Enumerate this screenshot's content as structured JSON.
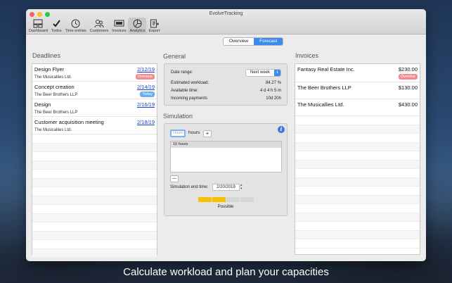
{
  "window": {
    "title": "EvolveTracking"
  },
  "toolbar": [
    {
      "label": "Dashboard",
      "icon": "dashboard-icon"
    },
    {
      "label": "Todos",
      "icon": "checkmark-icon"
    },
    {
      "label": "Time entries",
      "icon": "clock-icon"
    },
    {
      "label": "Customers",
      "icon": "people-icon"
    },
    {
      "label": "Invoices",
      "icon": "invoice-icon"
    },
    {
      "label": "Analytics",
      "icon": "analytics-icon",
      "active": true
    },
    {
      "label": "Export",
      "icon": "export-icon"
    }
  ],
  "view_switch": {
    "options": [
      "Overview",
      "Forecast"
    ],
    "selected": "Forecast"
  },
  "deadlines": {
    "title": "Deadlines",
    "items": [
      {
        "name": "Design Flyer",
        "date": "2/12/19",
        "client": "The Musicallies Ltd.",
        "badge": "Overdue"
      },
      {
        "name": "Concept creation",
        "date": "2/14/19",
        "client": "The Beer Brothers LLP",
        "badge": "Today"
      },
      {
        "name": "Design",
        "date": "2/16/19",
        "client": "The Beer Brothers LLP",
        "badge": ""
      },
      {
        "name": "Customer acquisition meeting",
        "date": "2/18/19",
        "client": "The Musicallies Ltd.",
        "badge": ""
      }
    ]
  },
  "general": {
    "title": "General",
    "date_range_label": "Date range:",
    "date_range_value": "Next week",
    "rows": [
      {
        "label": "Estimated workload:",
        "value": "84.27 %"
      },
      {
        "label": "Available time:",
        "value": "4 d 4 h 5 m"
      },
      {
        "label": "Incoming payments",
        "value": "10d 20h"
      }
    ]
  },
  "simulation": {
    "title": "Simulation",
    "hours_placeholder": "Hours",
    "hours_label": "hours",
    "add_label": "+",
    "remove_label": "—",
    "entries": [
      "10 hours"
    ],
    "end_time_label": "Simulation end time:",
    "end_time_value": "2/20/2019",
    "capacity_segments": 4,
    "capacity_filled": 2,
    "capacity_status": "Possible",
    "colors": {
      "filled": "#f6c100",
      "empty": "#d6d6d6"
    }
  },
  "invoices": {
    "title": "Invoices",
    "items": [
      {
        "name": "Fantasy Real Estate Inc.",
        "amount": "$230.00",
        "badge": "Overdue"
      },
      {
        "name": "The Beer Brothers LLP",
        "amount": "$130.00",
        "badge": ""
      },
      {
        "name": "The Musicallies Ltd.",
        "amount": "$430.00",
        "badge": ""
      }
    ]
  },
  "caption": "Calculate workload and plan your capacities"
}
